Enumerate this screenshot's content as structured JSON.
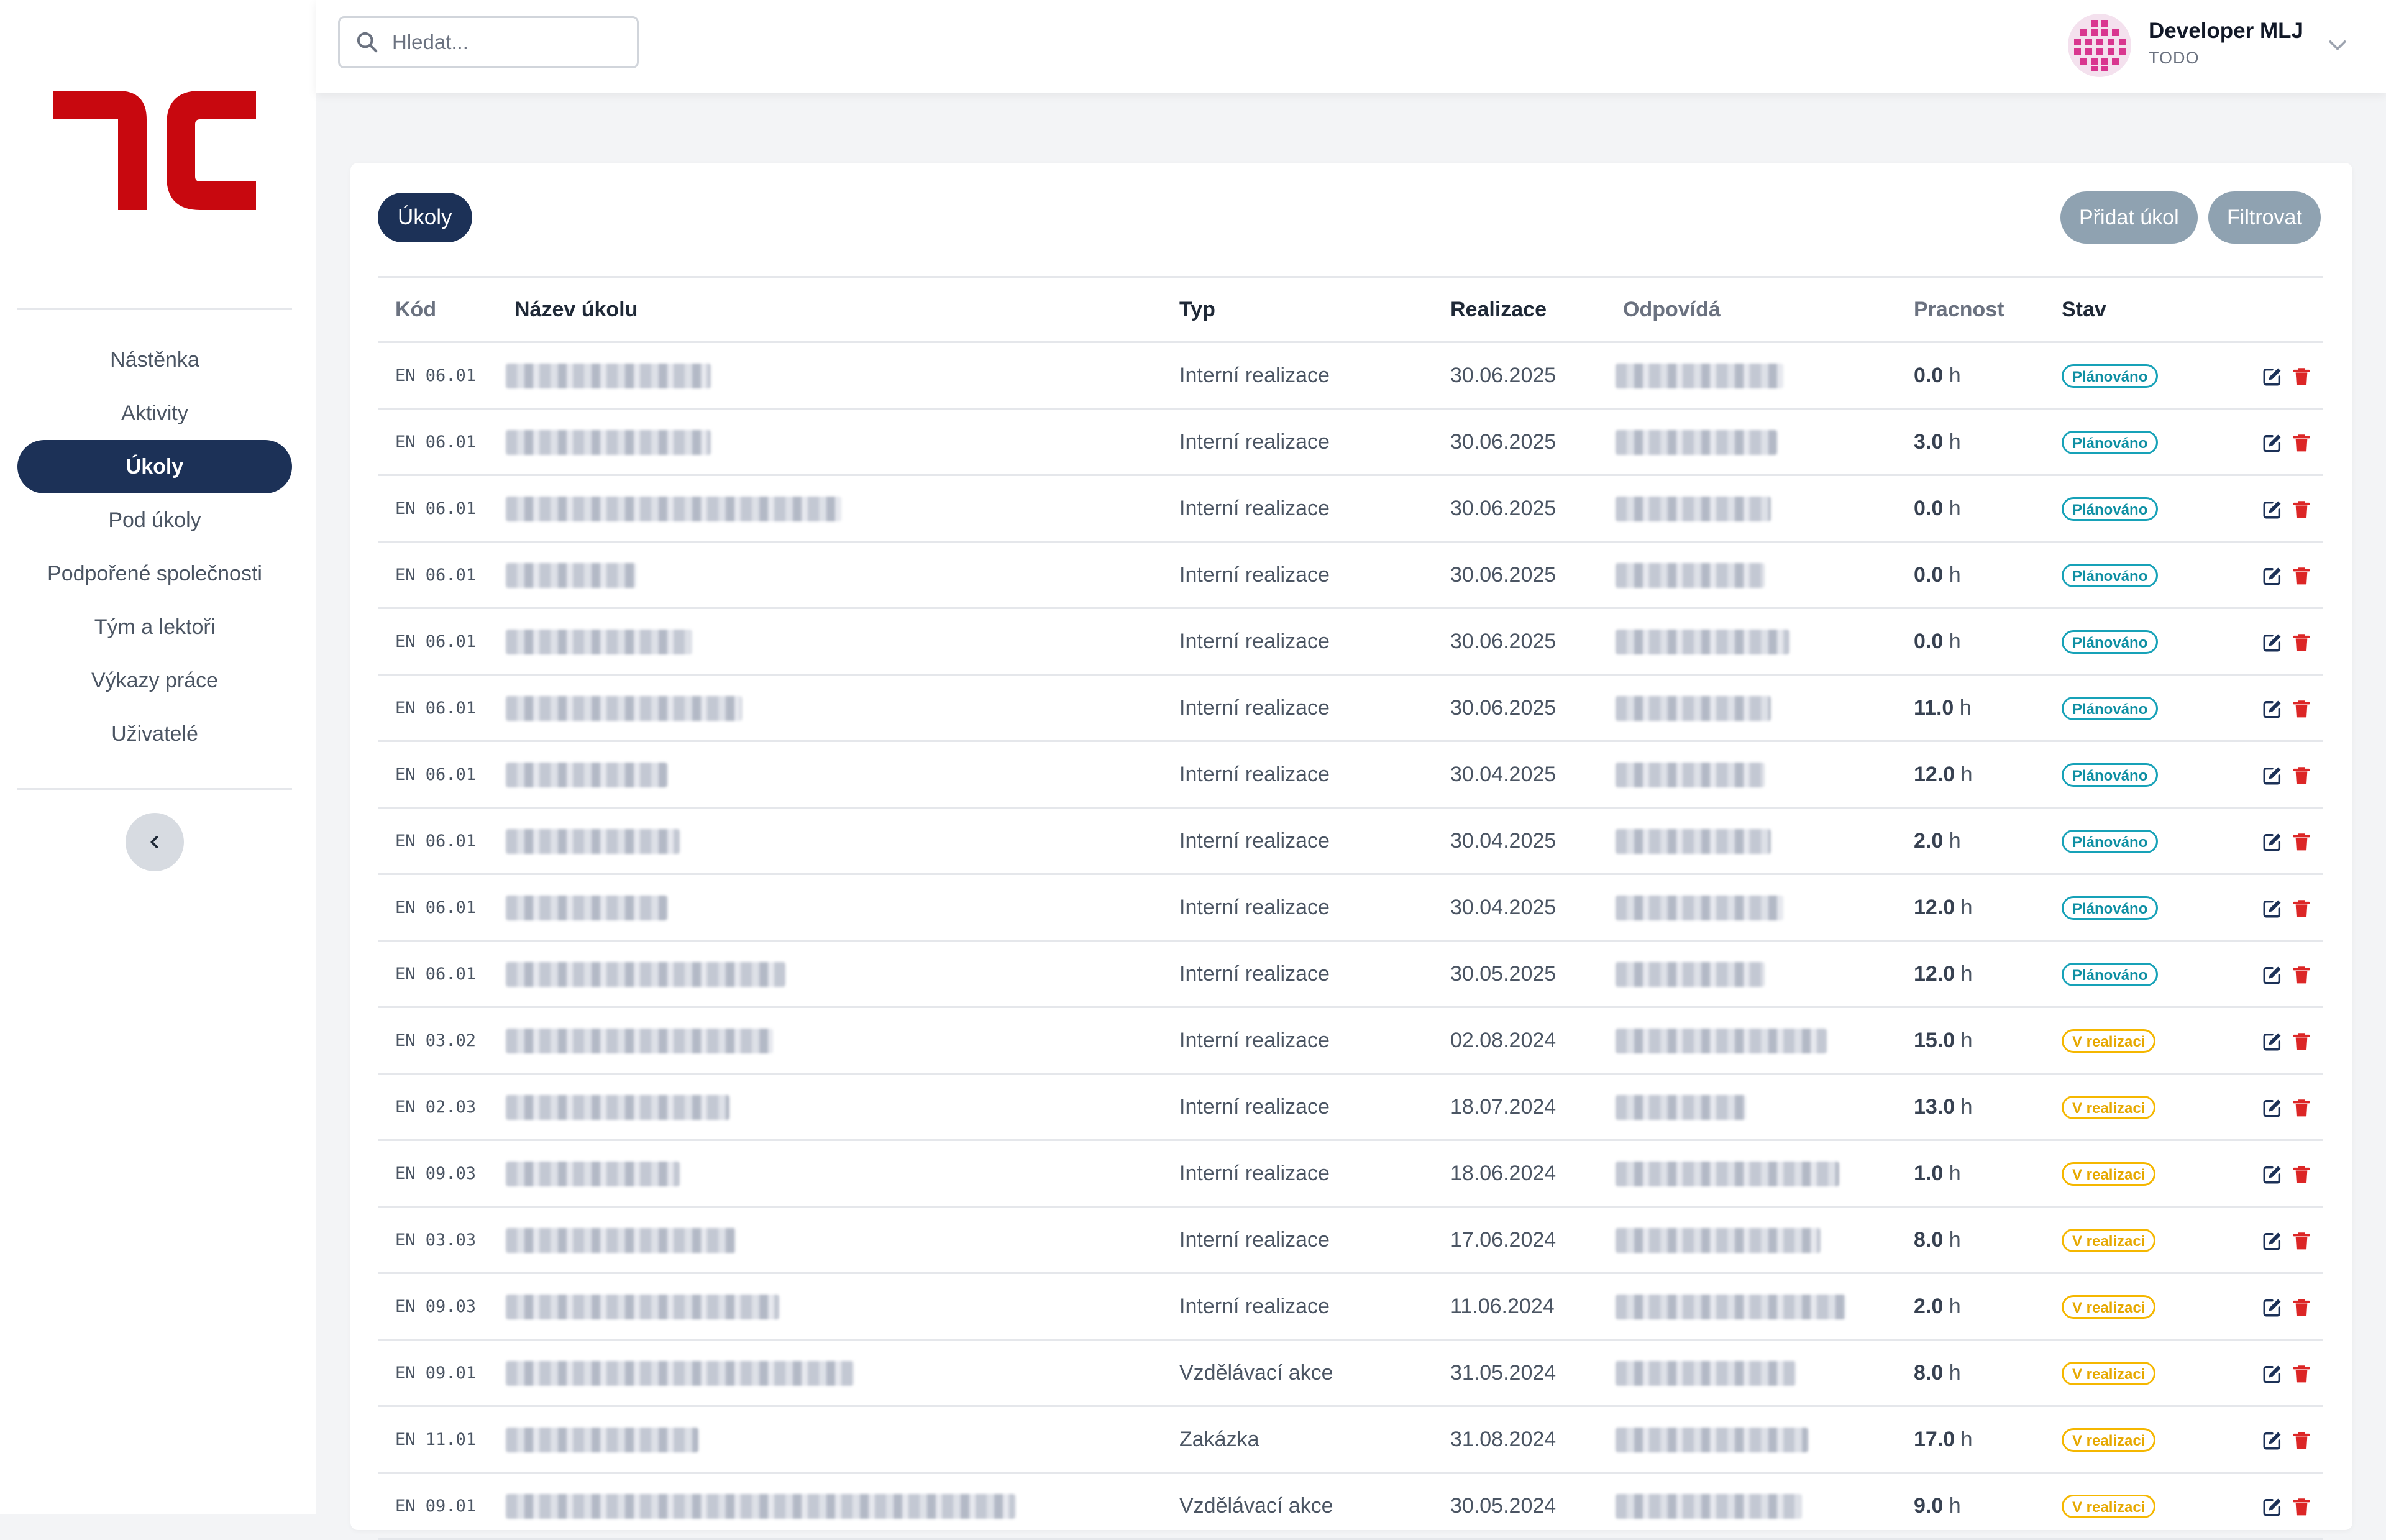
{
  "sidebar": {
    "nav": [
      {
        "label": "Nástěnka",
        "active": false
      },
      {
        "label": "Aktivity",
        "active": false
      },
      {
        "label": "Úkoly",
        "active": true
      },
      {
        "label": "Pod úkoly",
        "active": false
      },
      {
        "label": "Podpořené společnosti",
        "active": false
      },
      {
        "label": "Tým a lektoři",
        "active": false
      },
      {
        "label": "Výkazy práce",
        "active": false
      },
      {
        "label": "Uživatelé",
        "active": false
      }
    ],
    "collapse_icon": "chevron-left-icon"
  },
  "header": {
    "search_placeholder": "Hledat...",
    "user_name": "Developer MLJ",
    "user_role": "TODO"
  },
  "main": {
    "title": "Úkoly",
    "add_button": "Přidat úkol",
    "filter_button": "Filtrovat",
    "columns": [
      "Kód",
      "Název úkolu",
      "Typ",
      "Realizace",
      "Odpovídá",
      "Pracnost",
      "Stav"
    ],
    "hours_unit": "h",
    "rows": [
      {
        "code": "EN 06.01",
        "type": "Interní realizace",
        "date": "30.06.2025",
        "hours": "0.0",
        "status": "Plánováno"
      },
      {
        "code": "EN 06.01",
        "type": "Interní realizace",
        "date": "30.06.2025",
        "hours": "3.0",
        "status": "Plánováno"
      },
      {
        "code": "EN 06.01",
        "type": "Interní realizace",
        "date": "30.06.2025",
        "hours": "0.0",
        "status": "Plánováno"
      },
      {
        "code": "EN 06.01",
        "type": "Interní realizace",
        "date": "30.06.2025",
        "hours": "0.0",
        "status": "Plánováno"
      },
      {
        "code": "EN 06.01",
        "type": "Interní realizace",
        "date": "30.06.2025",
        "hours": "0.0",
        "status": "Plánováno"
      },
      {
        "code": "EN 06.01",
        "type": "Interní realizace",
        "date": "30.06.2025",
        "hours": "11.0",
        "status": "Plánováno"
      },
      {
        "code": "EN 06.01",
        "type": "Interní realizace",
        "date": "30.04.2025",
        "hours": "12.0",
        "status": "Plánováno"
      },
      {
        "code": "EN 06.01",
        "type": "Interní realizace",
        "date": "30.04.2025",
        "hours": "2.0",
        "status": "Plánováno"
      },
      {
        "code": "EN 06.01",
        "type": "Interní realizace",
        "date": "30.04.2025",
        "hours": "12.0",
        "status": "Plánováno"
      },
      {
        "code": "EN 06.01",
        "type": "Interní realizace",
        "date": "30.05.2025",
        "hours": "12.0",
        "status": "Plánováno"
      },
      {
        "code": "EN 03.02",
        "type": "Interní realizace",
        "date": "02.08.2024",
        "hours": "15.0",
        "status": "V realizaci"
      },
      {
        "code": "EN 02.03",
        "type": "Interní realizace",
        "date": "18.07.2024",
        "hours": "13.0",
        "status": "V realizaci"
      },
      {
        "code": "EN 09.03",
        "type": "Interní realizace",
        "date": "18.06.2024",
        "hours": "1.0",
        "status": "V realizaci"
      },
      {
        "code": "EN 03.03",
        "type": "Interní realizace",
        "date": "17.06.2024",
        "hours": "8.0",
        "status": "V realizaci"
      },
      {
        "code": "EN 09.03",
        "type": "Interní realizace",
        "date": "11.06.2024",
        "hours": "2.0",
        "status": "V realizaci"
      },
      {
        "code": "EN 09.01",
        "type": "Vzdělávací akce",
        "date": "31.05.2024",
        "hours": "8.0",
        "status": "V realizaci"
      },
      {
        "code": "EN 11.01",
        "type": "Zakázka",
        "date": "31.08.2024",
        "hours": "17.0",
        "status": "V realizaci"
      },
      {
        "code": "EN 09.01",
        "type": "Vzdělávací akce",
        "date": "30.05.2024",
        "hours": "9.0",
        "status": "V realizaci"
      }
    ]
  },
  "colors": {
    "brand_red": "#c8080f",
    "navy": "#1c3157",
    "planned": "#17a2b8",
    "in_progress": "#f5b700",
    "delete": "#dc2626"
  }
}
